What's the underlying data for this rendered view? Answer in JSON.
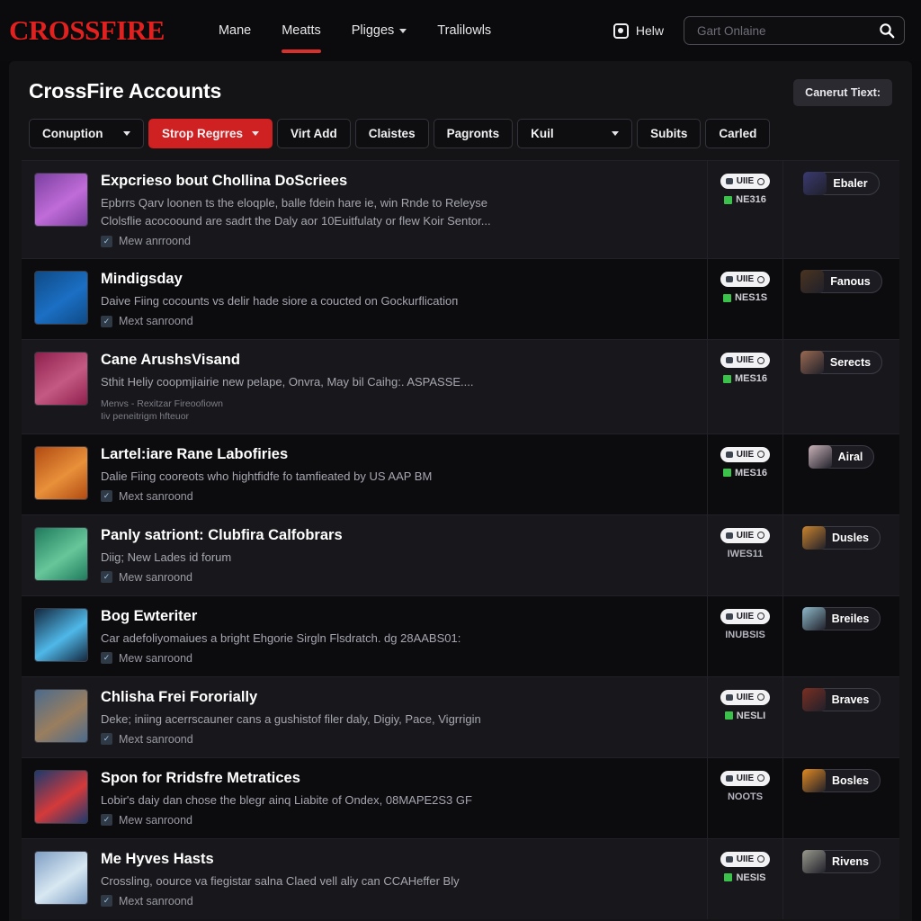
{
  "header": {
    "logo": "CROSSFIRE",
    "nav": [
      {
        "label": "Mane",
        "active": false,
        "caret": false
      },
      {
        "label": "Meatts",
        "active": true,
        "caret": false
      },
      {
        "label": "Pligges",
        "active": false,
        "caret": true
      },
      {
        "label": "Tralilowls",
        "active": false,
        "caret": false
      }
    ],
    "help_label": "Helw",
    "search_placeholder": "Gart Onlaine",
    "search_value": ""
  },
  "page": {
    "title": "CrossFire Accounts",
    "action_button": "Canerut Tiext:"
  },
  "filters": [
    {
      "label": "Conuption",
      "caret": true,
      "active": false
    },
    {
      "label": "Strop Regrres",
      "caret": true,
      "active": true
    },
    {
      "label": "Virt Add",
      "caret": false,
      "active": false
    },
    {
      "label": "Claistes",
      "caret": false,
      "active": false
    },
    {
      "label": "Pagronts",
      "caret": false,
      "active": false
    },
    {
      "label": "Kuil",
      "caret": true,
      "active": false
    },
    {
      "label": "Subits",
      "caret": false,
      "active": false
    },
    {
      "label": "Carled",
      "caret": false,
      "active": false
    }
  ],
  "colors": {
    "brand_red": "#e0211f",
    "active_red": "#cf2121",
    "status_green": "#3bc24a",
    "card_bg": "#141417"
  },
  "rows": [
    {
      "title": "Expcrieso bout Chollina DoScriees",
      "desc": "Epbrrs Qarv loonen ts the eloqple, balle fdein hare ie, win Rnde to Releyse",
      "desc2": "Clolsflie acocoound are sadrt the Daly aor 10Euitfulaty or flew Koir Sentor...",
      "meta": "Mew anrroond",
      "sub1": "",
      "sub2": "",
      "badge": "UIIE",
      "status": "NE316",
      "status_green": true,
      "chip": "Ebaler",
      "thumb": "#7b3fa0",
      "thumb2": "#c06cd8",
      "avatar": "#3a3a72"
    },
    {
      "title": "Mindigsday",
      "desc": "Daive Fiing cocounts vs delir hade siore a coucted on Gockurflicatioп",
      "desc2": "",
      "meta": "Mext sanroond",
      "sub1": "",
      "sub2": "",
      "badge": "UIIE",
      "status": "NES1S",
      "status_green": true,
      "chip": "Fanous",
      "thumb": "#0f4a86",
      "thumb2": "#1b6fc4",
      "avatar": "#4a3420"
    },
    {
      "title": "Cane ArushsVisand",
      "desc": "Sthit Heliy coopmjiairie new pelape, Onvra, May bil Caihg:. ASPASSE....",
      "desc2": "",
      "meta": "",
      "sub1": "Menvs  -  Rexitzar Fireoofiown",
      "sub2": "Iiv peneitrigm hfteuor",
      "badge": "UIIE",
      "status": "MES16",
      "status_green": true,
      "chip": "Serects",
      "thumb": "#8e1f4c",
      "thumb2": "#c45a84",
      "avatar": "#9a6a52"
    },
    {
      "title": "Lartel:iare Rane Labofiries",
      "desc": "Dalie Fiing cooreots who hightfidfe fo tamfieated by US AAP BM",
      "desc2": "",
      "meta": "Mext sanroond",
      "sub1": "",
      "sub2": "",
      "badge": "UIIE",
      "status": "MES16",
      "status_green": true,
      "chip": "Airal",
      "thumb": "#b14a12",
      "thumb2": "#e8903a",
      "avatar": "#c9b2b8"
    },
    {
      "title": "Panly satriont: Clubfira Calfobrars",
      "desc": "Diig; New Lades id forum",
      "desc2": "",
      "meta": "Mew sanroond",
      "sub1": "",
      "sub2": "",
      "badge": "UIIE",
      "status": "IWES11",
      "status_green": false,
      "chip": "Dusles",
      "thumb": "#1f7a5c",
      "thumb2": "#67c79a",
      "avatar": "#c9842e"
    },
    {
      "title": "Bog Ewteriter",
      "desc": "Car adefoliyomaiues a bright Ehgorie Sirgln Flsdratch. dg 28AABS01:",
      "desc2": "",
      "meta": "Mew sanroond",
      "sub1": "",
      "sub2": "",
      "badge": "UIIE",
      "status": "INUBSIS",
      "status_green": false,
      "chip": "Breiles",
      "thumb": "#13283f",
      "thumb2": "#4fb8e8",
      "avatar": "#8fb9c9"
    },
    {
      "title": "Chlisha Frei Fororially",
      "desc": "Deke; iniing acerrscauner cans a gushistof filer daly, Digiy, Pace, Vigrrigin",
      "desc2": "",
      "meta": "Mext sanroond",
      "sub1": "",
      "sub2": "",
      "badge": "UIIE",
      "status": "NESLI",
      "status_green": true,
      "chip": "Braves",
      "thumb": "#4b6b8c",
      "thumb2": "#9a7e5e",
      "avatar": "#7a2f22"
    },
    {
      "title": "Spon for Rridsfre Metratices",
      "desc": "Lobir's daiy dan chose the blegr ainq Liabite of Ondex, 08MAPE2S3 GF",
      "desc2": "",
      "meta": "Mew sanroond",
      "sub1": "",
      "sub2": "",
      "badge": "UIIE",
      "status": "NOOTS",
      "status_green": false,
      "chip": "Bosles",
      "thumb": "#1c3a6e",
      "thumb2": "#d43a3a",
      "avatar": "#e08a22"
    },
    {
      "title": "Me Hyves Hasts",
      "desc": "Crossling, oource va fiegistar salna Claed vell aliy can CCAHeffer Bly",
      "desc2": "",
      "meta": "Mext sanroond",
      "sub1": "",
      "sub2": "",
      "badge": "UIIE",
      "status": "NESIS",
      "status_green": true,
      "chip": "Rivens",
      "thumb": "#7e9ec4",
      "thumb2": "#d8e8f2",
      "avatar": "#9a9a8e"
    }
  ]
}
